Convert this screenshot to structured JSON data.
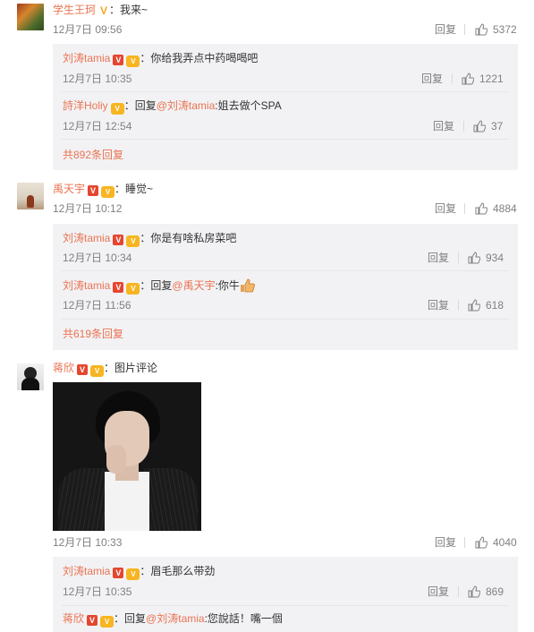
{
  "actions": {
    "reply": "回复"
  },
  "threads": [
    {
      "user": "学生王珂",
      "colon": "：",
      "text": "我来~",
      "time": "12月7日 09:56",
      "likes": "5372",
      "replies": [
        {
          "user": "刘涛tamia",
          "colon": "：",
          "text": "你给我弄点中药喝喝吧",
          "time": "12月7日 10:35",
          "likes": "1221"
        },
        {
          "user": "詩洋Holiy",
          "colon": "：",
          "prefix": "回复",
          "mention": "@刘涛tamia",
          "text": ":姐去做个SPA",
          "time": "12月7日 12:54",
          "likes": "37"
        }
      ],
      "more": "共892条回复"
    },
    {
      "user": "禹天宇",
      "colon": "：",
      "text": "睡觉~",
      "time": "12月7日 10:12",
      "likes": "4884",
      "replies": [
        {
          "user": "刘涛tamia",
          "colon": "：",
          "text": "你是有啥私房菜吧",
          "time": "12月7日 10:34",
          "likes": "934"
        },
        {
          "user": "刘涛tamia",
          "colon": "：",
          "prefix": "回复",
          "mention": "@禹天宇",
          "text": ":你牛",
          "time": "12月7日 11:56",
          "likes": "618"
        }
      ],
      "more": "共619条回复"
    },
    {
      "user": "蒋欣",
      "colon": "：",
      "text": "图片评论",
      "time": "12月7日 10:33",
      "likes": "4040",
      "replies": [
        {
          "user": "刘涛tamia",
          "colon": "：",
          "text": "眉毛那么带劲",
          "time": "12月7日 10:35",
          "likes": "869"
        },
        {
          "user": "蒋欣",
          "colon": "：",
          "prefix": "回复",
          "mention": "@刘涛tamia",
          "text": ":您說話！嘴一個"
        }
      ]
    }
  ],
  "icons": {
    "verified": "verified-v-icon",
    "vip": "vip-badge-icon",
    "like": "thumbs-up-icon",
    "emoji": "thumbs-up-emoji-icon"
  },
  "colors": {
    "username": "#eb7350",
    "meta": "#808080",
    "reply_bg": "#f2f2f5"
  }
}
